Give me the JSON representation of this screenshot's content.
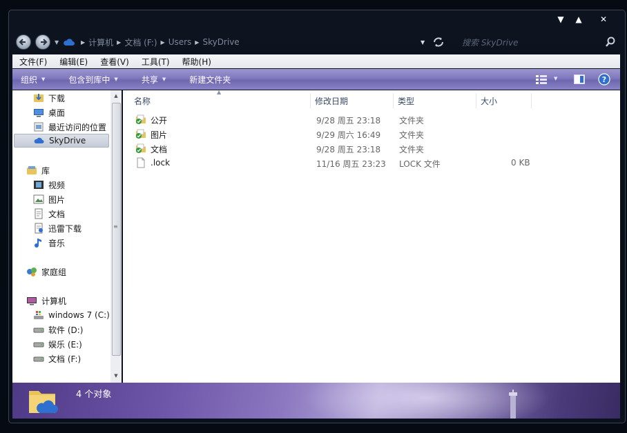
{
  "window": {
    "caption_buttons": [
      "▼",
      "▲",
      "✕"
    ]
  },
  "address": {
    "segments": [
      "计算机",
      "文档 (F:)",
      "Users",
      "SkyDrive"
    ],
    "search_placeholder": "搜索 SkyDrive"
  },
  "menu": [
    "文件(F)",
    "编辑(E)",
    "查看(V)",
    "工具(T)",
    "帮助(H)"
  ],
  "toolbar": {
    "organize": "组织",
    "include_in_library": "包含到库中",
    "share": "共享",
    "new_folder": "新建文件夹"
  },
  "nav_pane": {
    "favorites": [
      {
        "label": "下载",
        "icon": "download-folder-icon"
      },
      {
        "label": "桌面",
        "icon": "desktop-icon"
      },
      {
        "label": "最近访问的位置",
        "icon": "recent-places-icon"
      },
      {
        "label": "SkyDrive",
        "icon": "skydrive-icon"
      }
    ],
    "libraries_label": "库",
    "libraries": [
      {
        "label": "视频",
        "icon": "video-library-icon"
      },
      {
        "label": "图片",
        "icon": "pictures-library-icon"
      },
      {
        "label": "文档",
        "icon": "documents-library-icon"
      },
      {
        "label": "迅雷下载",
        "icon": "thunder-download-icon"
      },
      {
        "label": "音乐",
        "icon": "music-library-icon"
      }
    ],
    "homegroup_label": "家庭组",
    "computer_label": "计算机",
    "drives": [
      {
        "label": "windows 7 (C:)",
        "icon": "system-drive-icon"
      },
      {
        "label": "软件 (D:)",
        "icon": "drive-icon"
      },
      {
        "label": "娱乐 (E:)",
        "icon": "drive-icon"
      },
      {
        "label": "文档 (F:)",
        "icon": "drive-icon"
      }
    ]
  },
  "columns": {
    "name": "名称",
    "modified": "修改日期",
    "type": "类型",
    "size": "大小"
  },
  "files": [
    {
      "name": "公开",
      "modified": "9/28 周五 23:18",
      "type": "文件夹",
      "size": "",
      "icon": "synced-folder-icon"
    },
    {
      "name": "图片",
      "modified": "9/29 周六 16:49",
      "type": "文件夹",
      "size": "",
      "icon": "synced-folder-icon"
    },
    {
      "name": "文档",
      "modified": "9/28 周五 23:18",
      "type": "文件夹",
      "size": "",
      "icon": "synced-folder-icon"
    },
    {
      "name": ".lock",
      "modified": "11/16 周五 23:23",
      "type": "LOCK 文件",
      "size": "0 KB",
      "icon": "blank-file-icon"
    }
  ],
  "status": {
    "count_text": "4 个对象"
  },
  "colors": {
    "toolbar": "#7f78bd",
    "statusbar": "#6d55a8",
    "selection": "#c6ccd8"
  }
}
